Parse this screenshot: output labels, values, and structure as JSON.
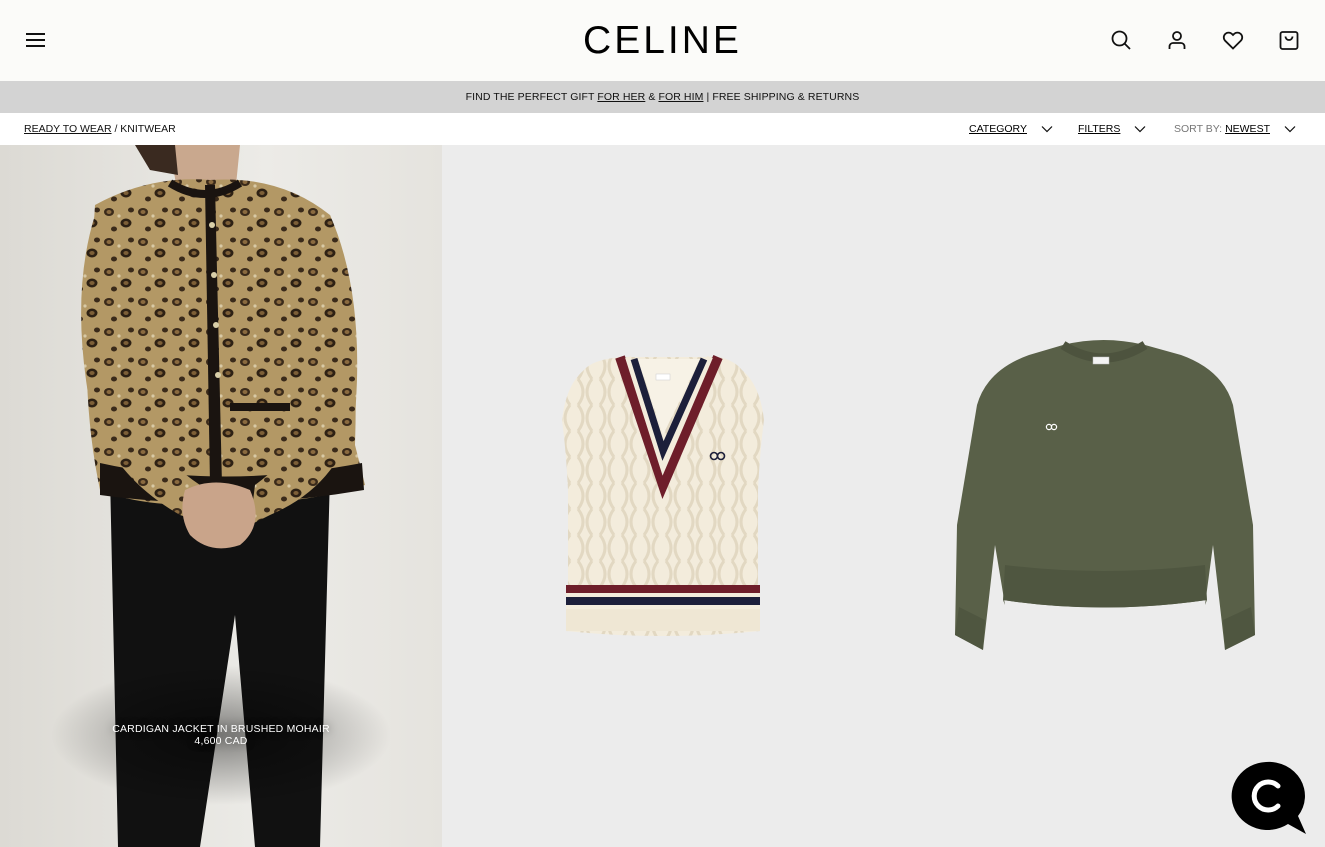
{
  "header": {
    "logo": "CELINE",
    "icons": [
      "menu-icon",
      "search-icon",
      "account-icon",
      "wishlist-icon",
      "bag-icon"
    ]
  },
  "promo": {
    "prefix": "FIND THE PERFECT GIFT ",
    "for_her": "FOR HER",
    "amp": " & ",
    "for_him": "FOR HIM",
    "suffix": " | FREE SHIPPING & RETURNS"
  },
  "breadcrumb": {
    "root": "READY TO WEAR",
    "separator": " / ",
    "current": "KNITWEAR"
  },
  "filters": {
    "category_label": "CATEGORY",
    "filters_label": "FILTERS",
    "sort_prefix": "SORT BY:",
    "sort_value": "NEWEST"
  },
  "products": [
    {
      "name": "CARDIGAN JACKET IN BRUSHED MOHAIR",
      "price": "4,600 CAD"
    },
    {
      "name": "",
      "price": ""
    },
    {
      "name": "",
      "price": ""
    }
  ],
  "colors": {
    "header_bg": "#fbfbf9",
    "promo_bg": "#d3d3d3",
    "tile_bg": "#ececec",
    "vest_cream": "#f2ead9",
    "vest_navy": "#1c1f3a",
    "vest_burgundy": "#6e1e2a",
    "sweater_green": "#5a6048",
    "leopard_base": "#b59a6a"
  }
}
